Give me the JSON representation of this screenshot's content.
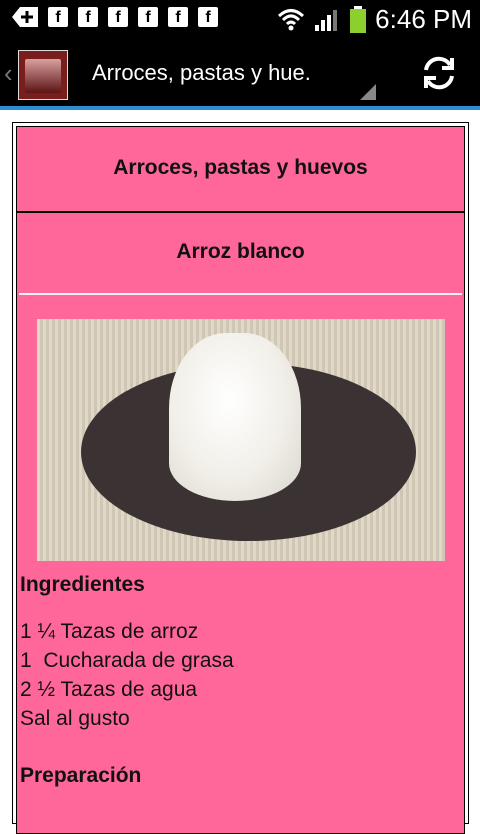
{
  "status_bar": {
    "time": "6:46 PM",
    "notification_icons": [
      "plus-icon",
      "facebook-icon",
      "facebook-icon",
      "facebook-icon",
      "facebook-icon",
      "facebook-icon",
      "facebook-icon"
    ],
    "fb_letter": "f"
  },
  "action_bar": {
    "title": "Arroces, pastas y hue.",
    "accent_color": "#2a8fd2"
  },
  "page": {
    "category_title": "Arroces, pastas y huevos",
    "recipe_title": "Arroz blanco",
    "ingredients_heading": "Ingredientes",
    "ingredients": [
      "1 ¼ Tazas de arroz",
      "1  Cucharada de grasa",
      "2 ½ Tazas de agua",
      "Sal al gusto"
    ],
    "preparation_heading": "Preparación",
    "background_color": "#ff6699"
  }
}
